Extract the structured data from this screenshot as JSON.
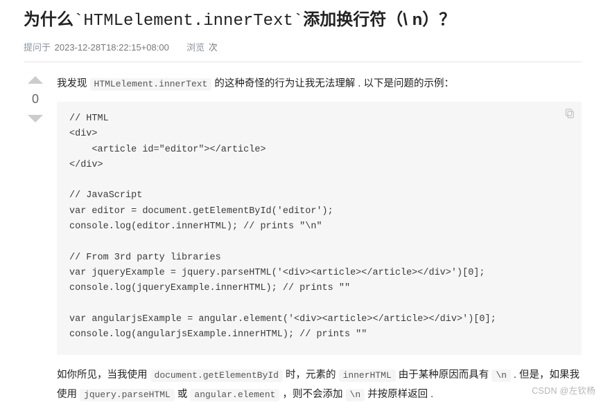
{
  "question": {
    "title_pre": "为什么",
    "title_code": "`HTMLelement.innerText`",
    "title_post": "添加换行符（\\ n）？",
    "meta": {
      "asked_label": "提问于",
      "asked_value": "2023-12-28T18:22:15+08:00",
      "views_label": "浏览",
      "views_suffix": "次"
    }
  },
  "votes": {
    "score": "0"
  },
  "body": {
    "p1_pre": "我发现 ",
    "p1_code": "HTMLelement.innerText",
    "p1_post": " 的这种奇怪的行为让我无法理解 . 以下是问题的示例：",
    "code": "// HTML\n<div>\n    <article id=\"editor\"></article>\n</div>\n\n// JavaScript\nvar editor = document.getElementById('editor');\nconsole.log(editor.innerHTML); // prints \"\\n\"\n\n// From 3rd party libraries\nvar jqueryExample = jquery.parseHTML('<div><article></article></div>')[0];\nconsole.log(jqueryExample.innerHTML); // prints \"\"\n\nvar angularjsExample = angular.element('<div><article></article></div>')[0];\nconsole.log(angularjsExample.innerHTML); // prints \"\"",
    "p2": {
      "t1": "如你所见，当我使用 ",
      "c1": "document.getElementById",
      "t2": " 时，元素的 ",
      "c2": "innerHTML",
      "t3": " 由于某种原因而具有 ",
      "c3": "\\n",
      "t4": " . 但是，如果我使用 ",
      "c4": "jquery.parseHTML",
      "t5": " 或 ",
      "c5": "angular.element",
      "t6": " ，则不会添加 ",
      "c6": "\\n",
      "t7": " 并按原样返回 ."
    }
  },
  "watermark": "CSDN @左钦杨"
}
